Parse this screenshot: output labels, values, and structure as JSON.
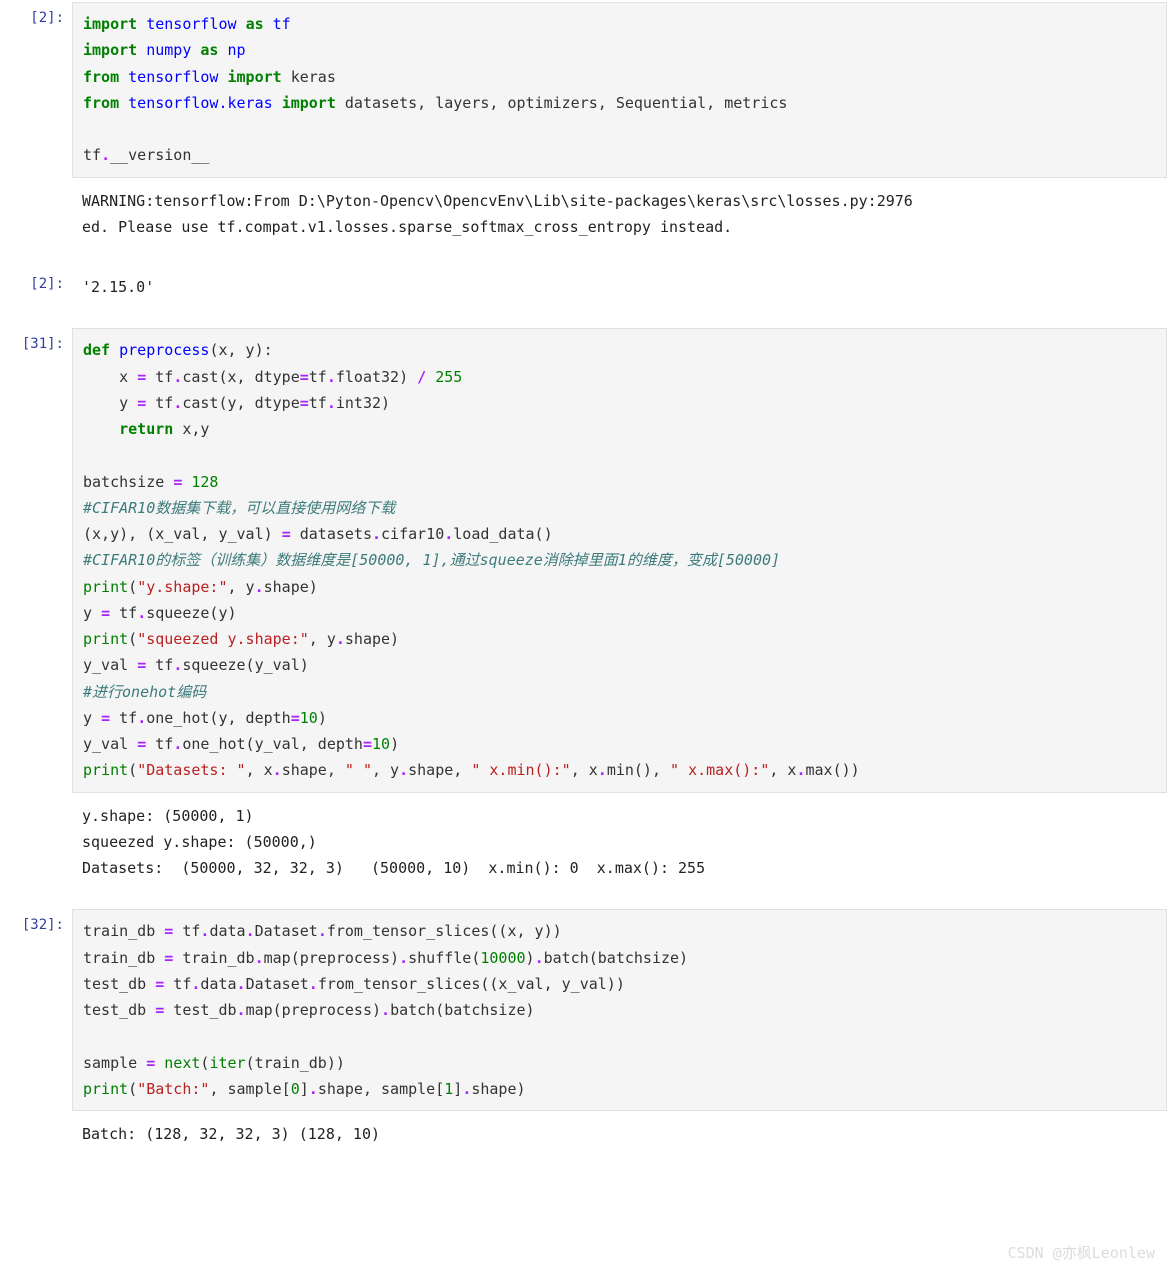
{
  "cells": {
    "c1": {
      "prompt": "[2]:",
      "code_html": "<span class='tok-k'>import</span> <span class='tok-nn'>tensorflow</span> <span class='tok-k'>as</span> <span class='tok-nn'>tf</span>\n<span class='tok-k'>import</span> <span class='tok-nn'>numpy</span> <span class='tok-k'>as</span> <span class='tok-nn'>np</span>\n<span class='tok-k'>from</span> <span class='tok-nn'>tensorflow</span> <span class='tok-k'>import</span> keras\n<span class='tok-k'>from</span> <span class='tok-nn'>tensorflow.keras</span> <span class='tok-k'>import</span> datasets, layers, optimizers, Sequential, metrics\n\ntf<span class='tok-o'>.</span>__version__",
      "stderr": "WARNING:tensorflow:From D:\\Pyton-Opencv\\OpencvEnv\\Lib\\site-packages\\keras\\src\\losses.py:2976\ned. Please use tf.compat.v1.losses.sparse_softmax_cross_entropy instead."
    },
    "c1r": {
      "prompt": "[2]:",
      "result": "'2.15.0'"
    },
    "c2": {
      "prompt": "[31]:",
      "code_html": "<span class='tok-k'>def</span> <span class='tok-nn'>preprocess</span>(x, y):\n    x <span class='tok-o'>=</span> tf<span class='tok-o'>.</span>cast(x, dtype<span class='tok-o'>=</span>tf<span class='tok-o'>.</span>float32) <span class='tok-o'>/</span> <span class='tok-m'>255</span>\n    y <span class='tok-o'>=</span> tf<span class='tok-o'>.</span>cast(y, dtype<span class='tok-o'>=</span>tf<span class='tok-o'>.</span>int32)\n    <span class='tok-k'>return</span> x,y\n\nbatchsize <span class='tok-o'>=</span> <span class='tok-m'>128</span>\n<span class='tok-c'>#CIFAR10数据集下载，可以直接使用网络下载</span>\n(x,y), (x_val, y_val) <span class='tok-o'>=</span> datasets<span class='tok-o'>.</span>cifar10<span class='tok-o'>.</span>load_data()\n<span class='tok-c'>#CIFAR10的标签（训练集）数据维度是[50000, 1],通过squeeze消除掉里面1的维度，变成[50000]</span>\n<span class='tok-bf'>print</span>(<span class='tok-s'>\"y.shape:\"</span>, y<span class='tok-o'>.</span>shape)\ny <span class='tok-o'>=</span> tf<span class='tok-o'>.</span>squeeze(y)\n<span class='tok-bf'>print</span>(<span class='tok-s'>\"squeezed y.shape:\"</span>, y<span class='tok-o'>.</span>shape)\ny_val <span class='tok-o'>=</span> tf<span class='tok-o'>.</span>squeeze(y_val)\n<span class='tok-c'>#进行onehot编码</span>\ny <span class='tok-o'>=</span> tf<span class='tok-o'>.</span>one_hot(y, depth<span class='tok-o'>=</span><span class='tok-m'>10</span>)\ny_val <span class='tok-o'>=</span> tf<span class='tok-o'>.</span>one_hot(y_val, depth<span class='tok-o'>=</span><span class='tok-m'>10</span>)\n<span class='tok-bf'>print</span>(<span class='tok-s'>\"Datasets: \"</span>, x<span class='tok-o'>.</span>shape, <span class='tok-s'>\" \"</span>, y<span class='tok-o'>.</span>shape, <span class='tok-s'>\" x.min():\"</span>, x<span class='tok-o'>.</span>min(), <span class='tok-s'>\" x.max():\"</span>, x<span class='tok-o'>.</span>max())",
      "stdout": "y.shape: (50000, 1)\nsqueezed y.shape: (50000,)\nDatasets:  (50000, 32, 32, 3)   (50000, 10)  x.min(): 0  x.max(): 255"
    },
    "c3": {
      "prompt": "[32]:",
      "code_html": "train_db <span class='tok-o'>=</span> tf<span class='tok-o'>.</span>data<span class='tok-o'>.</span>Dataset<span class='tok-o'>.</span>from_tensor_slices((x, y))\ntrain_db <span class='tok-o'>=</span> train_db<span class='tok-o'>.</span>map(preprocess)<span class='tok-o'>.</span>shuffle(<span class='tok-m'>10000</span>)<span class='tok-o'>.</span>batch(batchsize)\ntest_db <span class='tok-o'>=</span> tf<span class='tok-o'>.</span>data<span class='tok-o'>.</span>Dataset<span class='tok-o'>.</span>from_tensor_slices((x_val, y_val))\ntest_db <span class='tok-o'>=</span> test_db<span class='tok-o'>.</span>map(preprocess)<span class='tok-o'>.</span>batch(batchsize)\n\nsample <span class='tok-o'>=</span> <span class='tok-bf'>next</span>(<span class='tok-bf'>iter</span>(train_db))\n<span class='tok-bf'>print</span>(<span class='tok-s'>\"Batch:\"</span>, sample[<span class='tok-m'>0</span>]<span class='tok-o'>.</span>shape, sample[<span class='tok-m'>1</span>]<span class='tok-o'>.</span>shape)",
      "stdout": "Batch: (128, 32, 32, 3) (128, 10)"
    }
  },
  "watermark": "CSDN @亦枫Leonlew"
}
